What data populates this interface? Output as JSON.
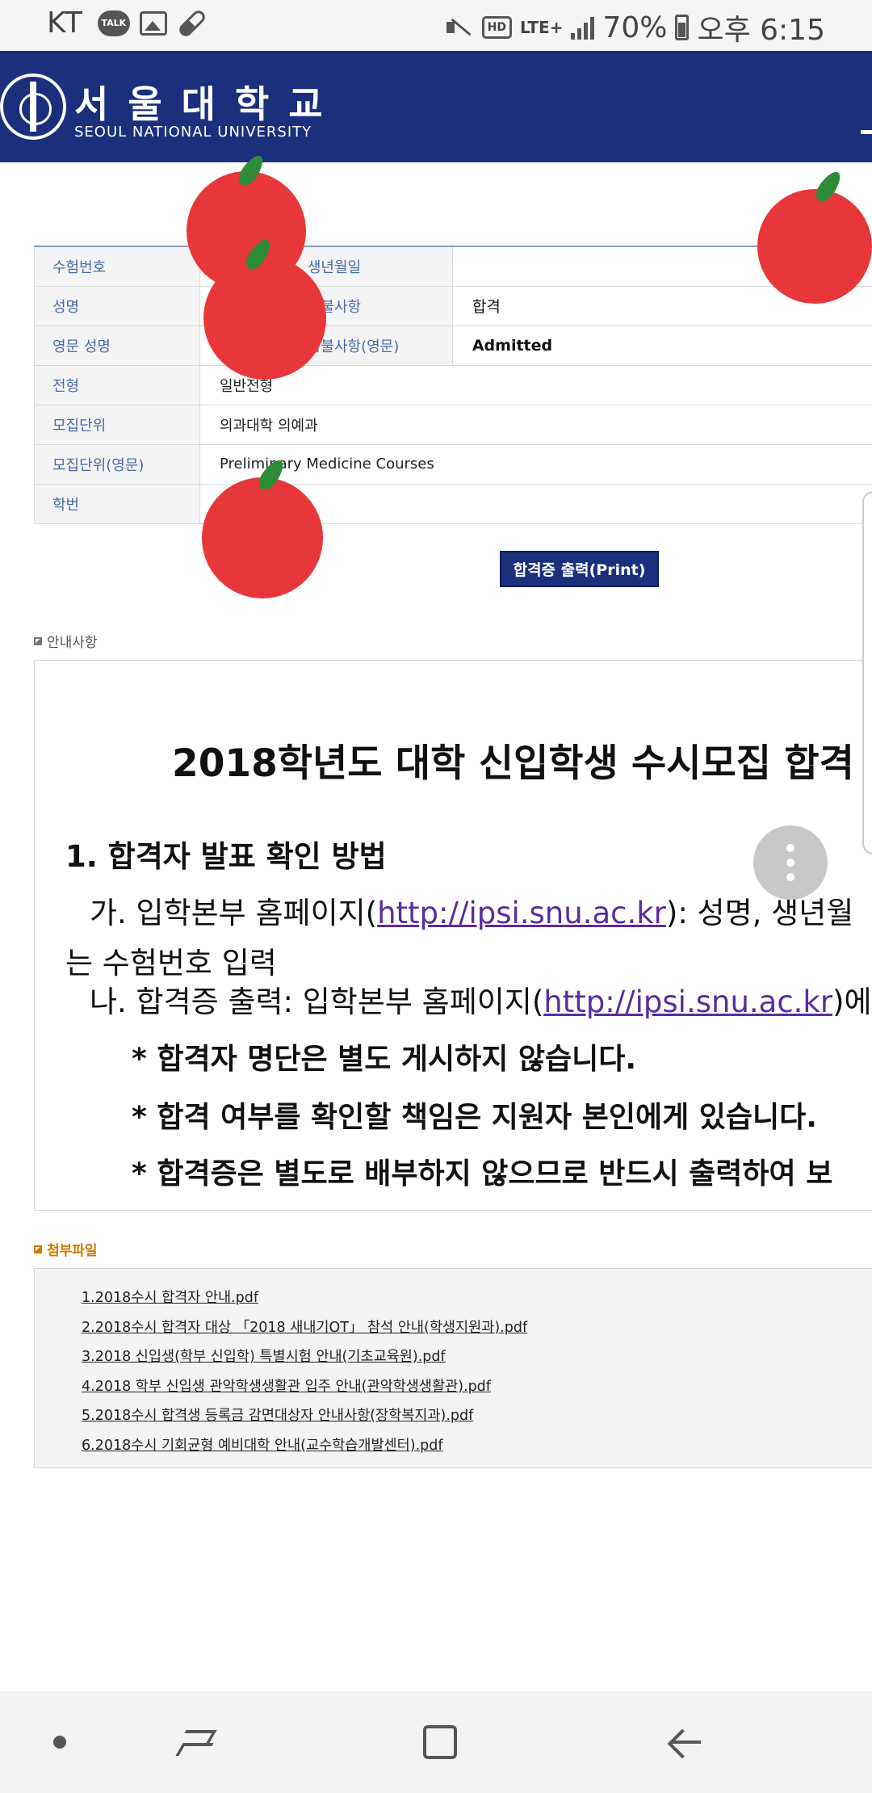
{
  "status_bar": {
    "carrier": "KT",
    "talk_badge": "TALK",
    "hd_badge": "HD",
    "network": "LTE+",
    "battery": "70%",
    "time": "오후 6:15",
    "icons": [
      "kakaotalk-icon",
      "gallery-icon",
      "pill-icon",
      "mute-icon",
      "hd-voice-icon",
      "signal-icon",
      "battery-icon"
    ]
  },
  "header": {
    "name_ko": "서울대학교",
    "name_en": "SEOUL NATIONAL UNIVERSITY",
    "brand_color": "#1b2f7d"
  },
  "info": {
    "exam_number_label": "수험번호",
    "birth_label": "생년월일",
    "name_label": "성명",
    "result_label": "합불사항",
    "result_value": "합격",
    "eng_name_label": "영문 성명",
    "result_en_label": "합불사항(영문)",
    "result_en_value": "Admitted",
    "track_label": "전형",
    "track_value": "일반전형",
    "unit_label": "모집단위",
    "unit_value": "의과대학 의예과",
    "unit_en_label": "모집단위(영문)",
    "unit_en_value": "Preliminary Medicine Courses",
    "student_id_label": "학번"
  },
  "print_button": "합격증 출력(Print)",
  "notice": {
    "section_title": "안내사항",
    "heading": "2018학년도 대학 신입학생 수시모집 합격",
    "item1_title": "1. 합격자 발표 확인 방법",
    "line_a_prefix": "가. 입학본부 홈페이지(",
    "line_a_link": "http://ipsi.snu.ac.kr",
    "line_a_suffix": "): 성명, 생년월",
    "line_a_cont": "는 수험번호 입력",
    "line_b_prefix": "나. 합격증 출력: 입학본부 홈페이지(",
    "line_b_link": "http://ipsi.snu.ac.kr",
    "line_b_suffix": ")에",
    "star1": "* 합격자 명단은 별도 게시하지 않습니다.",
    "star2": "* 합격 여부를 확인할 책임은 지원자 본인에게 있습니다.",
    "star3": "* 합격증은 별도로 배부하지 않으므로 반드시 출력하여 보"
  },
  "attachments": {
    "section_title": "첨부파일",
    "files": [
      "1.2018수시 합격자 안내.pdf",
      "2.2018수시 합격자 대상 「2018 새내기OT」 참석 안내(학생지원과).pdf",
      "3.2018 신입생(학부 신입학) 특별시험 안내(기초교육원).pdf",
      "4.2018 학부 신입생 관악학생생활관 입주 안내(관악학생생활관).pdf",
      "5.2018수시 합격생 등록금 감면대상자 안내사항(장학복지과).pdf",
      "6.2018수시 기회균형 예비대학 안내(교수학습개발센터).pdf"
    ]
  },
  "stickers": [
    "apple",
    "apple",
    "apple",
    "apple"
  ],
  "nav_bar": [
    "recent-apps-icon",
    "home-icon",
    "back-icon"
  ]
}
